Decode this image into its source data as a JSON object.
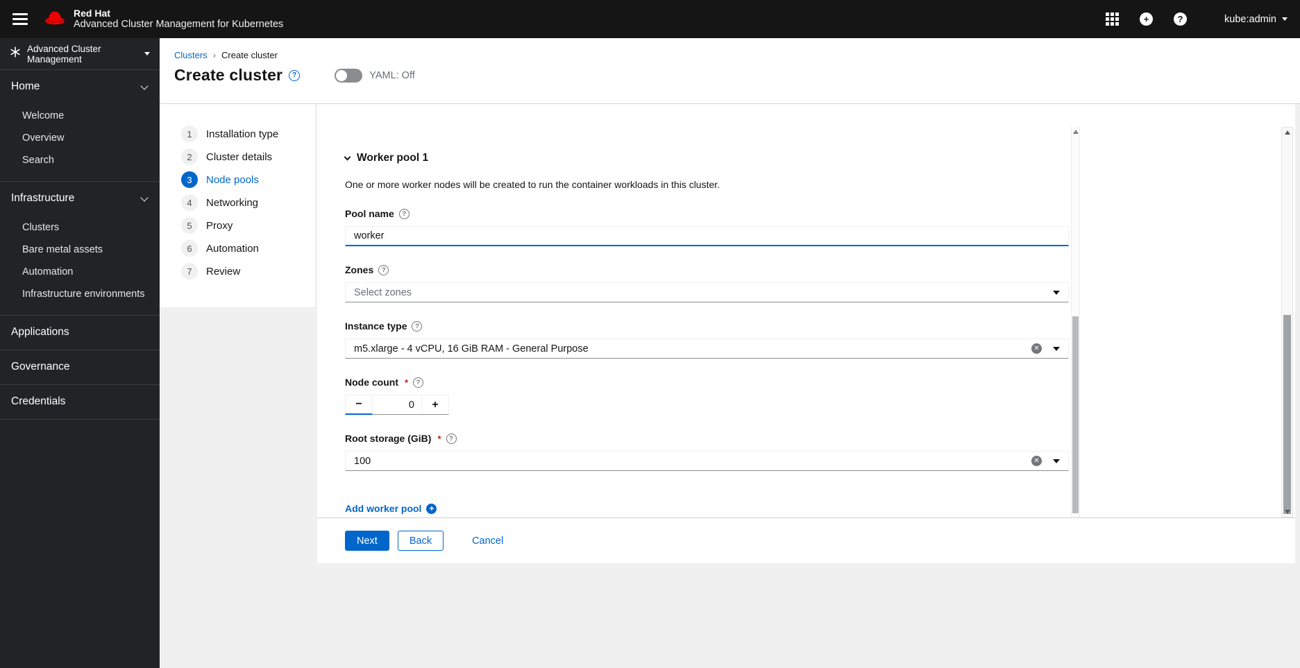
{
  "masthead": {
    "brand_line1": "Red Hat",
    "brand_line2": "Advanced Cluster Management for Kubernetes",
    "user_menu": "kube:admin",
    "icons": {
      "menu": "hamburger",
      "apps": "app-launcher-grid",
      "add": "plus-circle",
      "help": "question-circle"
    }
  },
  "sidebar": {
    "perspective": "Advanced Cluster Management",
    "groups": [
      {
        "label": "Home",
        "children": [
          "Welcome",
          "Overview",
          "Search"
        ]
      },
      {
        "label": "Infrastructure",
        "children": [
          "Clusters",
          "Bare metal assets",
          "Automation",
          "Infrastructure environments"
        ]
      },
      {
        "label": "Applications",
        "children": []
      },
      {
        "label": "Governance",
        "children": []
      },
      {
        "label": "Credentials",
        "children": []
      }
    ]
  },
  "breadcrumb": {
    "items": [
      "Clusters",
      "Create cluster"
    ]
  },
  "page": {
    "title": "Create cluster",
    "yaml_label": "YAML: Off"
  },
  "wizard": {
    "steps": [
      {
        "num": "1",
        "label": "Installation type"
      },
      {
        "num": "2",
        "label": "Cluster details"
      },
      {
        "num": "3",
        "label": "Node pools",
        "active": true
      },
      {
        "num": "4",
        "label": "Networking"
      },
      {
        "num": "5",
        "label": "Proxy"
      },
      {
        "num": "6",
        "label": "Automation"
      },
      {
        "num": "7",
        "label": "Review"
      }
    ]
  },
  "form": {
    "section_title": "Worker pool 1",
    "description": "One or more worker nodes will be created to run the container workloads in this cluster.",
    "pool_name": {
      "label": "Pool name",
      "value": "worker"
    },
    "zones": {
      "label": "Zones",
      "placeholder": "Select zones"
    },
    "instance_type": {
      "label": "Instance type",
      "value": "m5.xlarge - 4 vCPU, 16 GiB RAM - General Purpose"
    },
    "node_count": {
      "label": "Node count",
      "required": "*",
      "value": "0"
    },
    "root_storage": {
      "label": "Root storage (GiB)",
      "required": "*",
      "value": "100"
    },
    "add_worker_pool": "Add worker pool"
  },
  "footer": {
    "next": "Next",
    "back": "Back",
    "cancel": "Cancel"
  },
  "colors": {
    "accent": "#0066cc",
    "masthead_bg": "#151515",
    "sidebar_bg": "#212427",
    "brand_red": "#ee0000",
    "required_red": "#c9190b",
    "muted_text": "#6a6e73"
  }
}
